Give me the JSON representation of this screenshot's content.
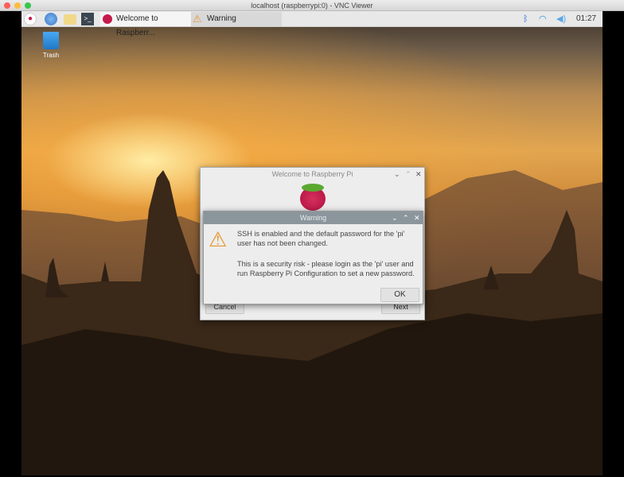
{
  "window": {
    "title": "localhost (raspberrypi:0) - VNC Viewer"
  },
  "taskbar": {
    "launchers": [
      "raspberry-menu-icon",
      "web-browser-icon",
      "file-manager-icon",
      "terminal-icon"
    ],
    "tasks": [
      {
        "label": "Welcome to Raspberr...",
        "icon": "raspberry-icon"
      },
      {
        "label": "Warning",
        "icon": "warning-icon"
      }
    ],
    "tray": {
      "bluetooth": "bluetooth-icon",
      "wifi": "wifi-icon",
      "volume": "volume-icon",
      "clock": "01:27"
    }
  },
  "desktop": {
    "icons": [
      {
        "label": "Trash"
      }
    ]
  },
  "welcome_dialog": {
    "title": "Welcome to Raspberry Pi",
    "cancel_label": "Cancel",
    "next_label": "Next"
  },
  "warning_dialog": {
    "title": "Warning",
    "line1": "SSH is enabled and the default password for the 'pi' user has not been changed.",
    "line2": "This is a security risk - please login as the 'pi' user and run Raspberry Pi Configuration to set a new password.",
    "ok_label": "OK"
  },
  "colors": {
    "warning_titlebar": "#8b969c",
    "taskbar": "#e8e8e8",
    "accent_raspberry": "#c51a4a"
  }
}
